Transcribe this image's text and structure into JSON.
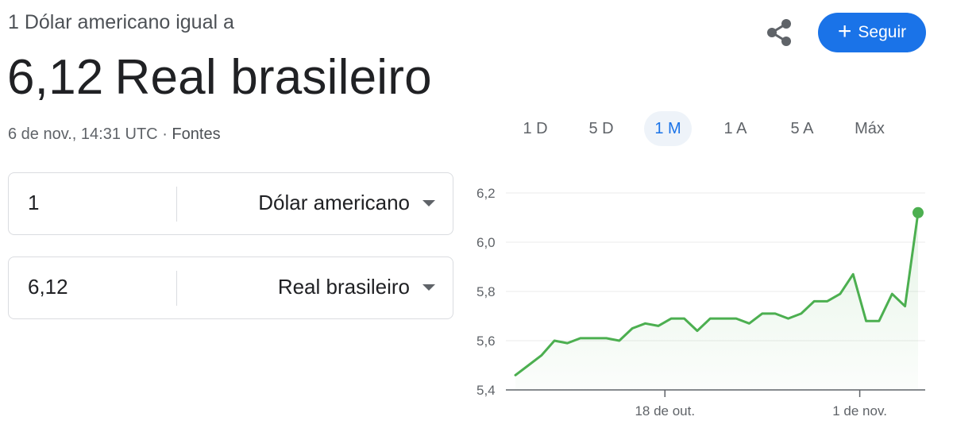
{
  "header": {
    "subtitle": "1 Dólar americano igual a",
    "value": "6,12",
    "currency_name": "Real brasileiro",
    "timestamp": "6 de nov., 14:31 UTC",
    "separator": "·",
    "sources_link": "Fontes"
  },
  "actions": {
    "share_icon": "share-icon",
    "follow_label": "Seguir",
    "follow_icon": "+",
    "accent_color": "#1a73e8"
  },
  "converter": {
    "from": {
      "amount": "1",
      "currency": "Dólar americano"
    },
    "to": {
      "amount": "6,12",
      "currency": "Real brasileiro"
    }
  },
  "range_tabs": {
    "items": [
      "1 D",
      "5 D",
      "1 M",
      "1 A",
      "5 A",
      "Máx"
    ],
    "selected": "1 M"
  },
  "chart_data": {
    "type": "line",
    "y_ticks": [
      "6,2",
      "6,0",
      "5,8",
      "5,6",
      "5,4"
    ],
    "ylim": [
      5.4,
      6.2
    ],
    "x_tick_labels": [
      "18 de out.",
      "1 de nov."
    ],
    "line_color": "#4caf50",
    "series": [
      {
        "values": [
          5.46,
          5.5,
          5.54,
          5.6,
          5.59,
          5.61,
          5.61,
          5.61,
          5.6,
          5.65,
          5.67,
          5.66,
          5.69,
          5.69,
          5.64,
          5.69,
          5.69,
          5.69,
          5.67,
          5.71,
          5.71,
          5.69,
          5.71,
          5.76,
          5.76,
          5.79,
          5.87,
          5.68,
          5.68,
          5.79,
          5.74,
          6.12
        ]
      }
    ]
  }
}
